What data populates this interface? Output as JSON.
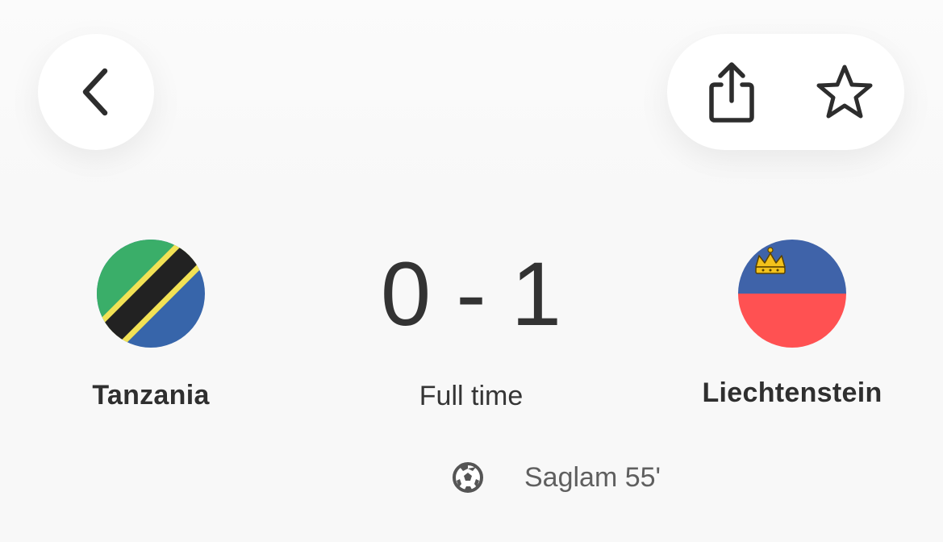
{
  "header": {
    "back_icon": "chevron-left-icon",
    "share_icon": "share-icon",
    "favorite_icon": "star-icon"
  },
  "match": {
    "home_team": {
      "name": "Tanzania",
      "flag_icon": "tanzania-flag-icon",
      "colors": {
        "green": "#3aae69",
        "blue": "#3765aa",
        "black": "#222222",
        "yellow": "#f2e255"
      }
    },
    "away_team": {
      "name": "Liechtenstein",
      "flag_icon": "liechtenstein-flag-icon",
      "colors": {
        "blue": "#3f63a9",
        "red": "#ff5152",
        "crown": "#f3c21b"
      }
    },
    "home_score": "0",
    "separator": "-",
    "away_score": "1",
    "status": "Full time"
  },
  "goals": [
    {
      "icon": "soccer-ball-icon",
      "scorer": "Saglam 55'"
    }
  ]
}
